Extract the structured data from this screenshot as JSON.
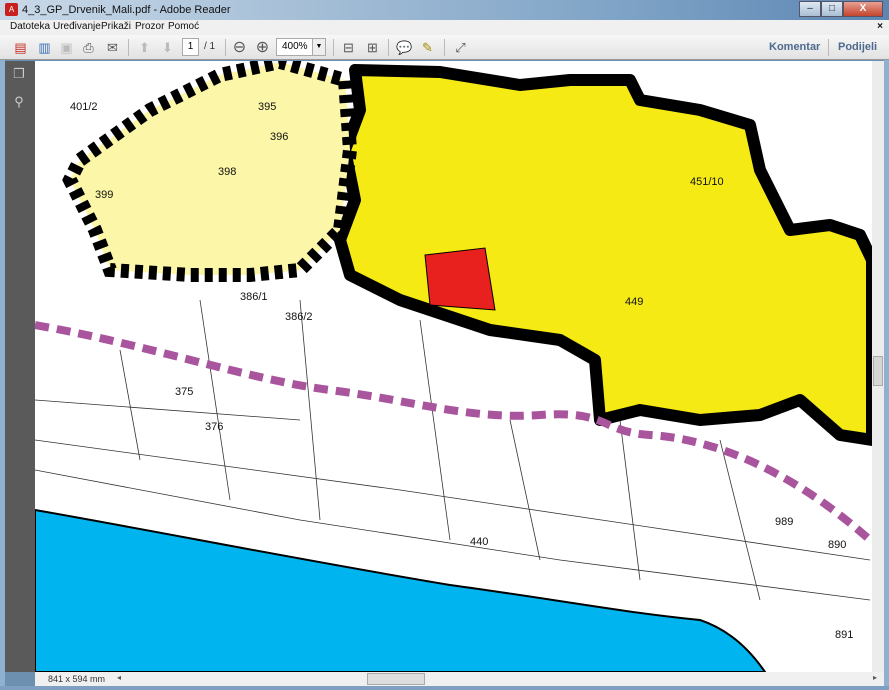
{
  "window": {
    "title": "4_3_GP_Drvenik_Mali.pdf - Adobe Reader",
    "minimize": "–",
    "maximize": "□",
    "close": "X"
  },
  "menu": [
    "Datoteka",
    "Uređivanje",
    "Prikaži",
    "Prozor",
    "Pomoć"
  ],
  "menu_close": "×",
  "toolbar": {
    "page_current": "1",
    "page_total": "/ 1",
    "zoom": "400%",
    "comment": "Komentar",
    "share": "Podijeli"
  },
  "status": {
    "page_size": "841 x 594 mm"
  },
  "map": {
    "colors": {
      "yellow": "#f6ea14",
      "light_yellow": "#fbf6a8",
      "red": "#e8201e",
      "sea": "#00b5ef",
      "boundary": "#000000",
      "route": "#a9559e"
    },
    "labels": [
      "401/2",
      "395",
      "398",
      "396",
      "399",
      "386/1",
      "386/2",
      "375",
      "376",
      "449",
      "451/10",
      "890",
      "891",
      "989",
      "440"
    ]
  }
}
